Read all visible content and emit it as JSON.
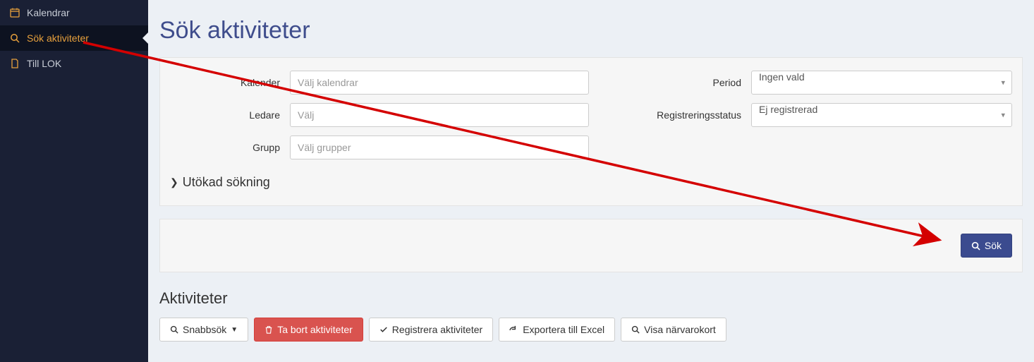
{
  "sidebar": {
    "items": [
      {
        "label": "Kalendrar",
        "icon": "calendar-icon"
      },
      {
        "label": "Sök aktiviteter",
        "icon": "search-icon"
      },
      {
        "label": "Till LOK",
        "icon": "file-icon"
      }
    ],
    "active_index": 1
  },
  "page": {
    "title": "Sök aktiviteter"
  },
  "filters": {
    "kalender": {
      "label": "Kalender",
      "placeholder": "Välj kalendrar",
      "value": ""
    },
    "ledare": {
      "label": "Ledare",
      "placeholder": "Välj",
      "value": ""
    },
    "grupp": {
      "label": "Grupp",
      "placeholder": "Välj grupper",
      "value": ""
    },
    "period": {
      "label": "Period",
      "value": "Ingen vald"
    },
    "regstatus": {
      "label": "Registreringsstatus",
      "value": "Ej registrerad"
    },
    "extended_label": "Utökad sökning"
  },
  "buttons": {
    "search": "Sök",
    "quick": "Snabbsök",
    "delete": "Ta bort aktiviteter",
    "register": "Registrera aktiviteter",
    "export": "Exportera till Excel",
    "showcard": "Visa närvarokort"
  },
  "section": {
    "title": "Aktiviteter"
  }
}
